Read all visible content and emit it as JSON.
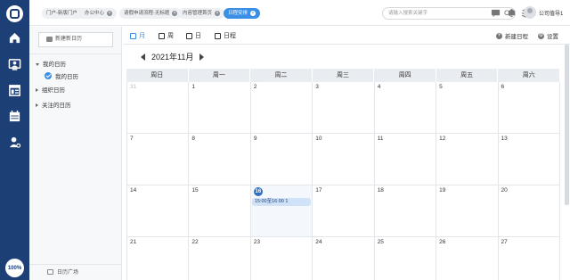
{
  "rail": {
    "zoom": "100%",
    "items": [
      "home-icon",
      "people-icon",
      "layout-icon",
      "calendar-icon",
      "user-settings-icon"
    ]
  },
  "topbar": {
    "tabs": [
      {
        "label": "门户-新版门户",
        "active": false
      },
      {
        "label": "办公中心",
        "active": false
      },
      {
        "label": "请假申请流程-无标题",
        "active": false
      },
      {
        "label": "内容管理首页",
        "active": false
      },
      {
        "label": "日程安排",
        "active": true
      }
    ],
    "search_placeholder": "请输入搜索关键字",
    "username": "公司值导1"
  },
  "sidebar": {
    "new_calendar": "新建新日历",
    "groups": [
      {
        "label": "我的日历",
        "expanded": true
      },
      {
        "label": "组织日历",
        "expanded": false
      },
      {
        "label": "关注的日历",
        "expanded": false
      }
    ],
    "my_calendar_item": "我的日历",
    "square": "日历广场"
  },
  "viewbar": {
    "views": [
      "月",
      "周",
      "日",
      "日程"
    ],
    "active_view": "月",
    "new_schedule": "新建日程",
    "settings": "设置"
  },
  "calendar": {
    "month_label": "2021年11月",
    "weekdays": [
      "周日",
      "周一",
      "周二",
      "周三",
      "周四",
      "周五",
      "周六"
    ],
    "weeks": [
      [
        {
          "d": "31",
          "muted": true
        },
        {
          "d": "1"
        },
        {
          "d": "2"
        },
        {
          "d": "3"
        },
        {
          "d": "4"
        },
        {
          "d": "5"
        },
        {
          "d": "6"
        }
      ],
      [
        {
          "d": "7"
        },
        {
          "d": "8"
        },
        {
          "d": "9"
        },
        {
          "d": "10"
        },
        {
          "d": "11"
        },
        {
          "d": "12"
        },
        {
          "d": "13"
        }
      ],
      [
        {
          "d": "14"
        },
        {
          "d": "15"
        },
        {
          "d": "16",
          "today": true,
          "event": "15:00至16:00 1"
        },
        {
          "d": "17"
        },
        {
          "d": "18"
        },
        {
          "d": "19"
        },
        {
          "d": "20"
        }
      ],
      [
        {
          "d": "21"
        },
        {
          "d": "22"
        },
        {
          "d": "23"
        },
        {
          "d": "24"
        },
        {
          "d": "25"
        },
        {
          "d": "26"
        },
        {
          "d": "27"
        }
      ]
    ]
  },
  "colors": {
    "rail": "#1c3f76",
    "accent": "#3a8ee6",
    "event": "#cfe2f7"
  }
}
